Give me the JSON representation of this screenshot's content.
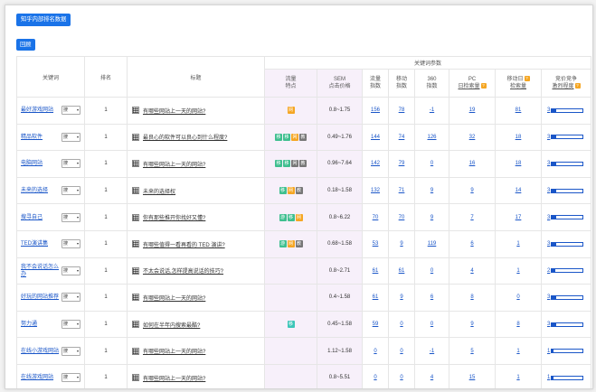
{
  "header_button": "知乎内部排名数据",
  "back_button": "回顾",
  "columns": {
    "keyword": "关键词",
    "rank": "排名",
    "title": "标题",
    "params": "关键词参数",
    "flow_feature": [
      "流量",
      "特点"
    ],
    "sem": [
      "SEM",
      "点击价格"
    ],
    "flow_index": [
      "流量",
      "指数"
    ],
    "mobile_index": [
      "移动",
      "指数"
    ],
    "s360_index": [
      "360",
      "指数"
    ],
    "pc_daily": [
      "PC",
      "日检索量"
    ],
    "mobile_daily": [
      "移动日",
      "检索量"
    ],
    "competition": [
      "竞价竞争",
      "激烈程度"
    ]
  },
  "search_label": "搜",
  "rows": [
    {
      "keyword": "最好游戏网站",
      "rank": "1",
      "title": "有哪些网站上一天的网站?",
      "badges": [
        {
          "t": "网",
          "c": "orange"
        }
      ],
      "sem": "0.8~1.75",
      "flow": "156",
      "mobile": "78",
      "s360": "-1",
      "pc": "19",
      "mob_daily": "81",
      "comp": "3",
      "comp_level": 0.15
    },
    {
      "keyword": "精品软件",
      "rank": "1",
      "title": "最良心的软件可以良心到什么程度?",
      "badges": [
        {
          "t": "移",
          "c": "green"
        },
        {
          "t": "移",
          "c": "green"
        },
        {
          "t": "网",
          "c": "orange"
        },
        {
          "t": "教",
          "c": "gray"
        }
      ],
      "sem": "0.49~1.76",
      "flow": "144",
      "mobile": "74",
      "s360": "126",
      "pc": "32",
      "mob_daily": "18",
      "comp": "3",
      "comp_level": 0.15
    },
    {
      "keyword": "电脑网站",
      "rank": "1",
      "title": "有哪些网站上一天的网站?",
      "badges": [
        {
          "t": "移",
          "c": "green"
        },
        {
          "t": "移",
          "c": "green"
        },
        {
          "t": "网",
          "c": "gray"
        },
        {
          "t": "教",
          "c": "gray"
        }
      ],
      "sem": "0.96~7.64",
      "flow": "142",
      "mobile": "79",
      "s360": "0",
      "pc": "16",
      "mob_daily": "18",
      "comp": "3",
      "comp_level": 0.15
    },
    {
      "keyword": "未来的选择",
      "rank": "1",
      "title": "未来的选择权",
      "badges": [
        {
          "t": "移",
          "c": "green"
        },
        {
          "t": "网",
          "c": "orange"
        },
        {
          "t": "教",
          "c": "gray"
        }
      ],
      "sem": "0.18~1.58",
      "flow": "132",
      "mobile": "71",
      "s360": "9",
      "pc": "9",
      "mob_daily": "14",
      "comp": "3",
      "comp_level": 0.15
    },
    {
      "keyword": "搜寻自己",
      "rank": "1",
      "title": "你有那些推开你找好又懂?",
      "badges": [
        {
          "t": "游",
          "c": "green"
        },
        {
          "t": "移",
          "c": "green"
        },
        {
          "t": "网",
          "c": "orange"
        }
      ],
      "sem": "0.8~6.22",
      "flow": "70",
      "mobile": "70",
      "s360": "9",
      "pc": "7",
      "mob_daily": "17",
      "comp": "3",
      "comp_level": 0.15
    },
    {
      "keyword": "TED演讲集",
      "rank": "1",
      "title": "有哪些值得一看再看的 TED 演讲?",
      "badges": [
        {
          "t": "游",
          "c": "green"
        },
        {
          "t": "网",
          "c": "orange"
        },
        {
          "t": "教",
          "c": "gray"
        }
      ],
      "sem": "0.68~1.58",
      "flow": "53",
      "mobile": "9",
      "s360": "119",
      "pc": "6",
      "mob_daily": "1",
      "comp": "3",
      "comp_level": 0.15
    },
    {
      "keyword": "我不会说话怎么办",
      "rank": "1",
      "title": "不太会说话,怎样提高说话的技巧?",
      "badges": [],
      "sem": "0.8~2.71",
      "flow": "61",
      "mobile": "61",
      "s360": "0",
      "pc": "4",
      "mob_daily": "1",
      "comp": "2",
      "comp_level": 0.1
    },
    {
      "keyword": "好玩的网站推荐",
      "rank": "1",
      "title": "有哪些网站上一天的网站?",
      "badges": [],
      "sem": "0.4~1.58",
      "flow": "61",
      "mobile": "9",
      "s360": "6",
      "pc": "8",
      "mob_daily": "0",
      "comp": "3",
      "comp_level": 0.15
    },
    {
      "keyword": "努力通",
      "rank": "1",
      "title": "如何在半年内搜索最酷?",
      "badges": [
        {
          "t": "移",
          "c": "teal"
        }
      ],
      "sem": "0.45~1.58",
      "flow": "59",
      "mobile": "0",
      "s360": "0",
      "pc": "9",
      "mob_daily": "8",
      "comp": "3",
      "comp_level": 0.15
    },
    {
      "keyword": "在线小游戏网站",
      "rank": "1",
      "title": "有哪些网站上一天的网站?",
      "badges": [],
      "sem": "1.12~1.58",
      "flow": "0",
      "mobile": "0",
      "s360": "-1",
      "pc": "5",
      "mob_daily": "1",
      "comp": "1",
      "comp_level": 0.05
    },
    {
      "keyword": "在线游戏网站",
      "rank": "1",
      "title": "有哪些网站上一天的网站?",
      "badges": [],
      "sem": "0.8~5.51",
      "flow": "0",
      "mobile": "0",
      "s360": "4",
      "pc": "15",
      "mob_daily": "1",
      "comp": "1",
      "comp_level": 0.05
    }
  ],
  "colors": {
    "accent": "#1a73e8",
    "badge_orange": "#f5a623",
    "badge_green": "#3fbf8f",
    "badge_gray": "#777777",
    "badge_teal": "#3cc6b8",
    "sem_bg": "#f7f0fa"
  }
}
